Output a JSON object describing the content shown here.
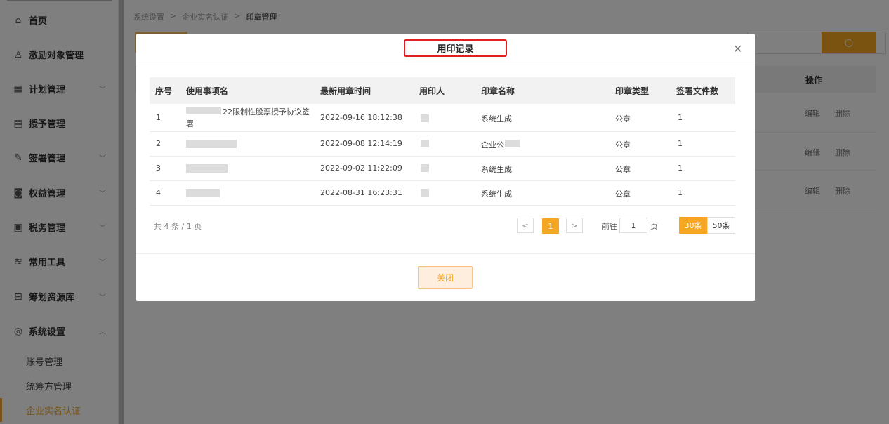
{
  "sidebar": {
    "items": [
      {
        "label": "首页",
        "icon": "home-icon",
        "has_chevron": false
      },
      {
        "label": "激励对象管理",
        "icon": "users-icon",
        "has_chevron": false
      },
      {
        "label": "计划管理",
        "icon": "grid-icon",
        "has_chevron": true
      },
      {
        "label": "授予管理",
        "icon": "document-icon",
        "has_chevron": false
      },
      {
        "label": "签署管理",
        "icon": "pen-icon",
        "has_chevron": true
      },
      {
        "label": "权益管理",
        "icon": "equity-icon",
        "has_chevron": true
      },
      {
        "label": "税务管理",
        "icon": "tax-icon",
        "has_chevron": true
      },
      {
        "label": "常用工具",
        "icon": "layers-icon",
        "has_chevron": true
      },
      {
        "label": "筹划资源库",
        "icon": "library-icon",
        "has_chevron": true
      },
      {
        "label": "系统设置",
        "icon": "settings-icon",
        "has_chevron": true
      }
    ],
    "subitems": [
      {
        "label": "账号管理",
        "active": false
      },
      {
        "label": "统筹方管理",
        "active": false
      },
      {
        "label": "企业实名认证",
        "active": true
      }
    ]
  },
  "breadcrumb": [
    "系统设置",
    "企业实名认证",
    "印章管理"
  ],
  "background_table": {
    "op_header": "操作",
    "rows": [
      {
        "edit": "编辑",
        "delete": "删除"
      },
      {
        "edit": "编辑",
        "delete": "删除"
      },
      {
        "edit": "编辑",
        "delete": "删除"
      }
    ]
  },
  "modal": {
    "title": "用印记录",
    "close_icon": "close-icon",
    "columns": [
      "序号",
      "使用事项名",
      "最新用章时间",
      "用印人",
      "印章名称",
      "印章类型",
      "签署文件数"
    ],
    "rows": [
      {
        "index": "1",
        "item_line1": "22限制性股票授予协议签",
        "item_line2": "署",
        "time": "2022-09-16 18:12:38",
        "user": "",
        "seal_name": "系统生成",
        "seal_type": "公章",
        "count": "1"
      },
      {
        "index": "2",
        "item_line1": "",
        "item_line2": "",
        "time": "2022-09-08 12:14:19",
        "user": "",
        "seal_name": "企业公",
        "seal_type": "公章",
        "count": "1"
      },
      {
        "index": "3",
        "item_line1": "",
        "item_line2": "",
        "time": "2022-09-02 11:22:09",
        "user": "",
        "seal_name": "系统生成",
        "seal_type": "公章",
        "count": "1"
      },
      {
        "index": "4",
        "item_line1": "",
        "item_line2": "",
        "time": "2022-08-31 16:23:31",
        "user": "",
        "seal_name": "系统生成",
        "seal_type": "公章",
        "count": "1"
      }
    ],
    "pagination": {
      "total_text": "共 4 条 / 1 页",
      "prev": "<",
      "current_page": "1",
      "next": ">",
      "goto_label": "前往",
      "goto_value": "1",
      "goto_suffix": "页",
      "size_30": "30条",
      "size_50": "50条"
    },
    "close_button": "关闭"
  },
  "colors": {
    "accent": "#f5a623",
    "title_highlight": "#e02020"
  }
}
